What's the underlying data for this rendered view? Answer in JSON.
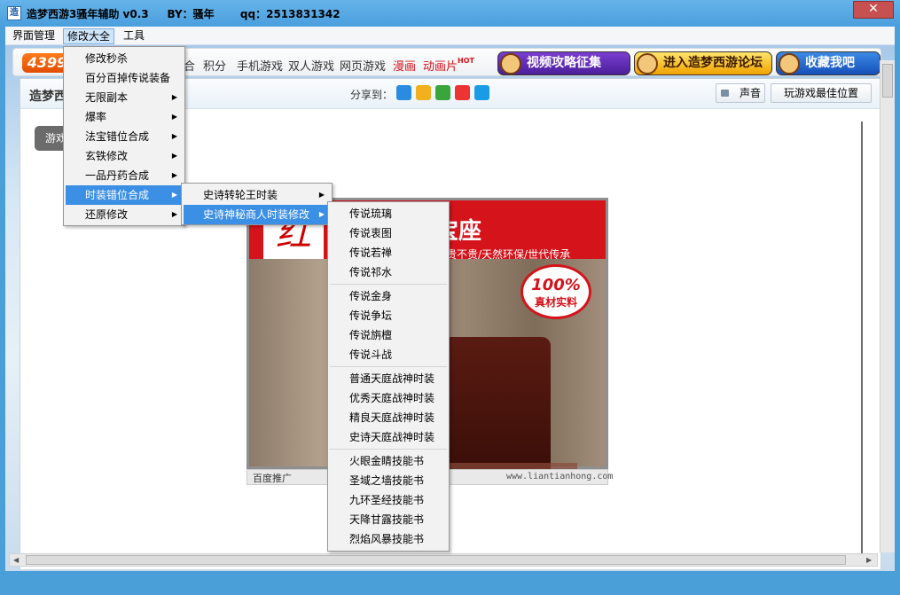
{
  "window": {
    "title": "造梦西游3骚年辅助 v0.3     BY：骚年       qq：2513831342",
    "close_glyph": "✕"
  },
  "menubar": [
    {
      "label": "界面管理"
    },
    {
      "label": "修改大全"
    },
    {
      "label": "工具"
    }
  ],
  "site_toolbar": {
    "logo": "4399",
    "nav": [
      "合",
      "积分",
      "手机游戏",
      "双人游戏",
      "网页游戏",
      "漫画",
      "动画片"
    ],
    "hot_badge": "HOT",
    "promos": [
      "视频攻略征集",
      "进入造梦西游论坛",
      "收藏我吧"
    ]
  },
  "game_panel": {
    "title": "造梦西",
    "share_label": "分享到：",
    "share_icons": [
      {
        "icon": "qzone-icon",
        "color": "#2a8ce0"
      },
      {
        "icon": "star-icon",
        "color": "#f2b01e"
      },
      {
        "icon": "clover-icon",
        "color": "#3aa53a"
      },
      {
        "icon": "weibo-icon",
        "color": "#e33"
      },
      {
        "icon": "qq-icon",
        "color": "#1a9be6"
      }
    ],
    "sound_button": "声音",
    "best_position_button": "玩游戏最佳位置",
    "game_button": "游戏"
  },
  "ad": {
    "logo_text": "红",
    "title": "宝座",
    "slogan": "高贵不贵/天然环保/世代传承",
    "seal_percent": "100%",
    "seal_text": "真材实料",
    "baidu_label": "百度推广",
    "url": "www.liantianhong.com"
  },
  "menu_main": [
    {
      "label": "修改秒杀",
      "sub": false
    },
    {
      "label": "百分百掉传说装备",
      "sub": false
    },
    {
      "label": "无限副本",
      "sub": true
    },
    {
      "label": "爆率",
      "sub": true
    },
    {
      "label": "法宝错位合成",
      "sub": true
    },
    {
      "label": "玄铁修改",
      "sub": true
    },
    {
      "label": "一品丹药合成",
      "sub": true
    },
    {
      "label": "时装错位合成",
      "sub": true
    },
    {
      "label": "还原修改",
      "sub": true
    }
  ],
  "menu_sub1": [
    {
      "label": "史诗转轮王时装"
    },
    {
      "label": "史诗神秘商人时装修改"
    }
  ],
  "menu_sub2": {
    "group1": [
      "传说琉璃",
      "传说衷图",
      "传说若禅",
      "传说祁水"
    ],
    "group2": [
      "传说金身",
      "传说争坛",
      "传说旃檀",
      "传说斗战"
    ],
    "group3": [
      "普通天庭战神时装",
      "优秀天庭战神时装",
      "精良天庭战神时装",
      "史诗天庭战神时装"
    ],
    "group4": [
      "火眼金睛技能书",
      "圣域之墙技能书",
      "九环圣经技能书",
      "天降甘露技能书",
      "烈焰风暴技能书"
    ]
  },
  "submenu_arrow": "▶"
}
